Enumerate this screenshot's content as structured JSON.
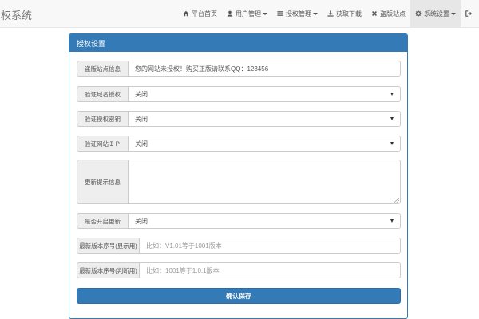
{
  "brand": {
    "title": "权系统"
  },
  "nav": {
    "items": [
      {
        "icon": "home-icon",
        "label": "平台首页"
      },
      {
        "icon": "user-icon",
        "label": "用户管理"
      },
      {
        "icon": "list-icon",
        "label": "授权管理"
      },
      {
        "icon": "download-icon",
        "label": "获取下载"
      },
      {
        "icon": "close-icon",
        "label": "盗版站点"
      },
      {
        "icon": "gear-icon",
        "label": "系统设置"
      },
      {
        "icon": "logout-icon",
        "label": ""
      }
    ]
  },
  "panel": {
    "title": "授权设置",
    "fields": {
      "piracy_info": {
        "label": "盗版站点信息",
        "value": "您的网站未授权！购买正版请联系QQ：123456"
      },
      "verify_domain": {
        "label": "验证域名授权",
        "value": "关闭"
      },
      "verify_key": {
        "label": "验证授权密钥",
        "value": "关闭"
      },
      "verify_ip": {
        "label": "验证网站ＩＰ",
        "value": "关闭"
      },
      "update_notice": {
        "label": "更新提示信息",
        "value": ""
      },
      "enable_update": {
        "label": "是否开启更新",
        "value": "关闭"
      },
      "version_display": {
        "label": "最新版本序号(显示用)",
        "placeholder": "比如：V1.01等于1001版本"
      },
      "version_judge": {
        "label": "最新版本序号(判断用)",
        "placeholder": "比如：1001等于1.0.1版本"
      }
    },
    "submit_label": "确认保存"
  }
}
